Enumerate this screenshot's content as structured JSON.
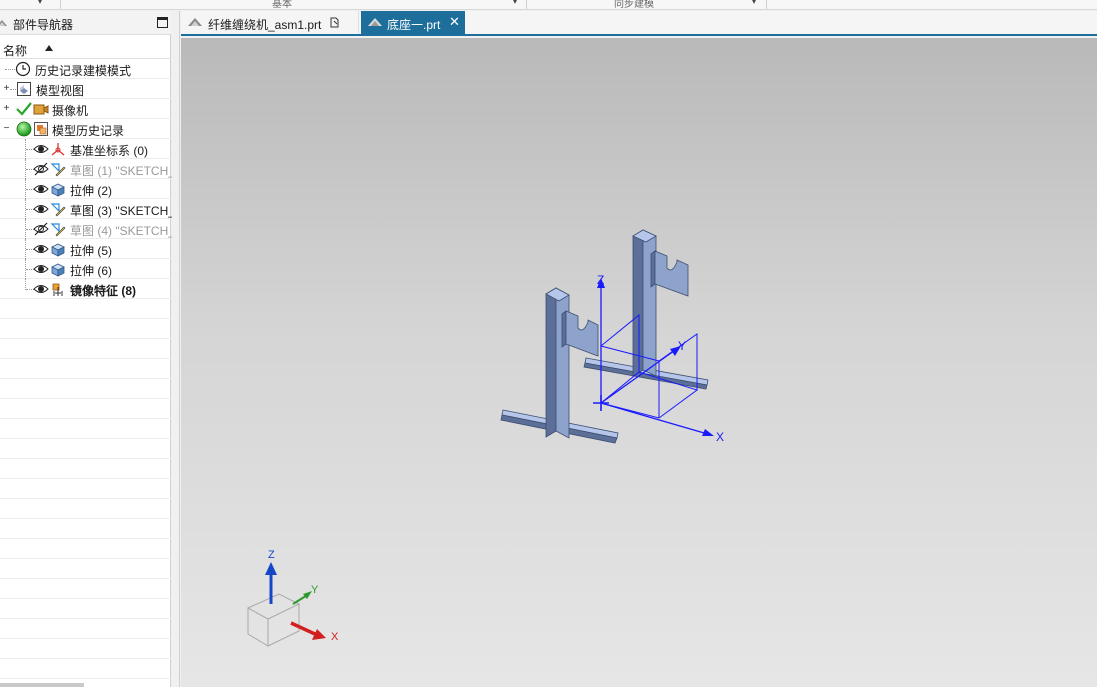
{
  "ribbon": {
    "group1": "基本",
    "group2": "同步建模"
  },
  "navigator": {
    "title": "部件导航器",
    "column_name": "名称",
    "items": [
      {
        "label": "历史记录建模模式",
        "style": "normal"
      },
      {
        "label": "模型视图",
        "style": "normal"
      },
      {
        "label": "摄像机",
        "style": "normal"
      },
      {
        "label": "模型历史记录",
        "style": "normal"
      },
      {
        "label": "基准坐标系 (0)",
        "style": "normal"
      },
      {
        "label": "草图 (1) \"SKETCH_",
        "style": "grey"
      },
      {
        "label": "拉伸 (2)",
        "style": "normal"
      },
      {
        "label": "草图 (3) \"SKETCH_",
        "style": "normal"
      },
      {
        "label": "草图 (4) \"SKETCH_",
        "style": "grey"
      },
      {
        "label": "拉伸 (5)",
        "style": "normal"
      },
      {
        "label": "拉伸 (6)",
        "style": "normal"
      },
      {
        "label": "镜像特征 (8)",
        "style": "bold"
      }
    ]
  },
  "tabs": [
    {
      "label": "纤维缠绕机_asm1.prt",
      "active": false
    },
    {
      "label": "底座一.prt",
      "active": true
    }
  ],
  "viewport": {
    "csys_axes": {
      "x": "X",
      "y": "Y",
      "z": "Z"
    },
    "triad_axes": {
      "x": "X",
      "y": "Y",
      "z": "Z"
    }
  },
  "colors": {
    "accent": "#1e6e9c",
    "part_face": "#8ea3cc",
    "part_light": "#b5c6ea",
    "part_dark": "#5b6f99",
    "csys": "#1a1aff",
    "triad_x": "#d21f1f",
    "triad_y": "#2e9a2e",
    "triad_z": "#1646c8"
  }
}
